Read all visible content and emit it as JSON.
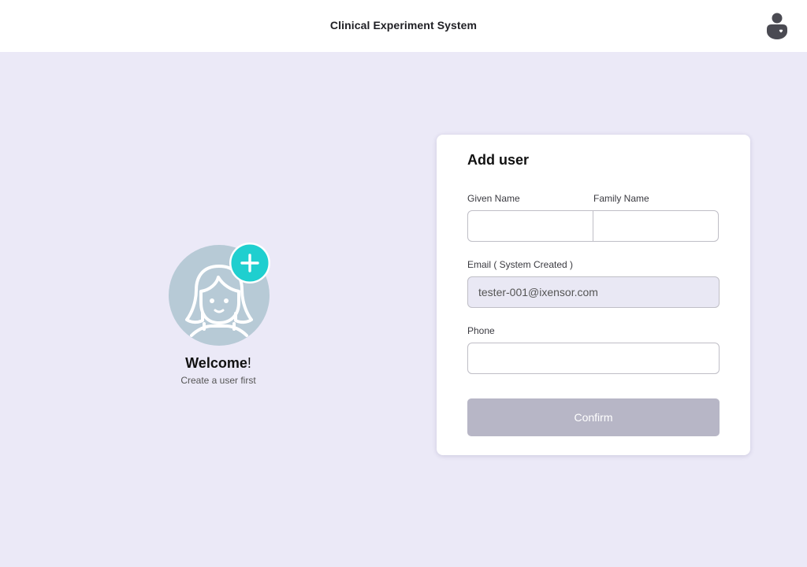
{
  "header": {
    "title": "Clinical Experiment System",
    "user_icon": "user-account-icon"
  },
  "welcome": {
    "greeting_bold": "Welcome",
    "greeting_suffix": "!",
    "subtitle": "Create a user first",
    "avatar_icon": "female-avatar-icon",
    "add_icon": "plus-icon"
  },
  "form": {
    "title": "Add user",
    "given_name_label": "Given Name",
    "given_name_value": "",
    "family_name_label": "Family Name",
    "family_name_value": "",
    "email_label": "Email ( System Created )",
    "email_value": "tester-001@ixensor.com",
    "phone_label": "Phone",
    "phone_value": "",
    "confirm_label": "Confirm"
  },
  "colors": {
    "page_background": "#ebe9f7",
    "accent": "#1fcfcf",
    "avatar_background": "#b7cad6",
    "confirm_disabled": "#b7b6c6"
  }
}
